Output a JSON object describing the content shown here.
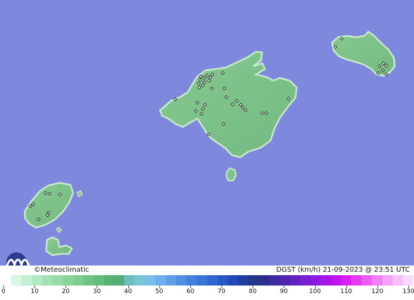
{
  "map": {
    "colors": {
      "sea": "#7e89dd",
      "land": "#7fc48a",
      "coast": "#bfe5c4",
      "border": "#333333"
    },
    "copyright": "©Meteoclimatic",
    "variable_label": "DGST (km/h)   21-09-2023 @ 23:51 UTC",
    "legend": {
      "tick_labels": [
        "0",
        "10",
        "20",
        "30",
        "40",
        "50",
        "60",
        "70",
        "80",
        "90",
        "100",
        "110",
        "120",
        "130"
      ],
      "colors": [
        "#ffffff",
        "#d9f6e4",
        "#c3efd3",
        "#b0e9c3",
        "#a3e1b5",
        "#96dba7",
        "#8ad49b",
        "#7ccd8f",
        "#6fc483",
        "#63bc7a",
        "#58b36f",
        "#55ad7c",
        "#6dbfbe",
        "#79c6d4",
        "#79bfe6",
        "#6eadee",
        "#5f9fe8",
        "#4f90e2",
        "#4382dc",
        "#3875d6",
        "#2f67cf",
        "#2758c8",
        "#1e4ab7",
        "#1d409e",
        "#223787",
        "#2c2f8a",
        "#3d2c9c",
        "#4f27ae",
        "#6222bf",
        "#771ed1",
        "#8d1ae1",
        "#a615ea",
        "#c013f0",
        "#d91ff3",
        "#e63bf2",
        "#ed5cf4",
        "#f17ff6",
        "#f4a0f8",
        "#f7bffa",
        "#fadafc"
      ]
    },
    "stations_count_hint": "station markers"
  }
}
